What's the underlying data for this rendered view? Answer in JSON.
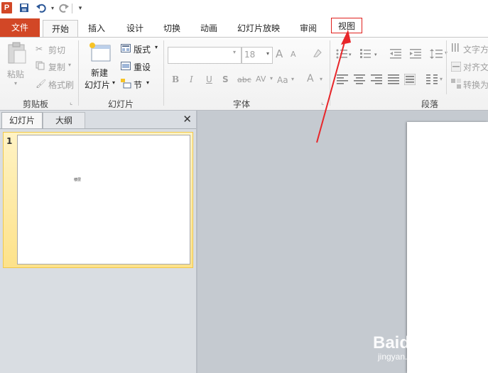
{
  "qat": {
    "logo": "P"
  },
  "tabs": [
    {
      "label": "文件"
    },
    {
      "label": "开始"
    },
    {
      "label": "插入"
    },
    {
      "label": "设计"
    },
    {
      "label": "切换"
    },
    {
      "label": "动画"
    },
    {
      "label": "幻灯片放映"
    },
    {
      "label": "审阅"
    },
    {
      "label": "视图"
    }
  ],
  "clipboard": {
    "paste": "粘贴",
    "cut": "剪切",
    "copy": "复制",
    "format_painter": "格式刷",
    "group": "剪贴板"
  },
  "slides": {
    "new_slide_line1": "新建",
    "new_slide_line2": "幻灯片",
    "layout": "版式",
    "reset": "重设",
    "section": "节",
    "group": "幻灯片"
  },
  "font": {
    "size": "18",
    "bold": "B",
    "italic": "I",
    "underline": "U",
    "shadow": "S",
    "strike": "abc",
    "spacing": "AV",
    "case": "Aa",
    "color": "A",
    "grow": "A",
    "shrink": "A",
    "group": "字体"
  },
  "paragraph": {
    "text_direction": "文字方",
    "align_text": "对齐文",
    "convert": "转换为",
    "group": "段落"
  },
  "panel": {
    "tab_slides": "幻灯片",
    "tab_outline": "大纲",
    "close": "✕",
    "slide_number": "1",
    "thumb_text": "楼层"
  },
  "watermark": {
    "line1": "Baidu 经验",
    "line2": "jingyan.baidu.com"
  },
  "colors": {
    "accent": "#d24726",
    "highlight": "#e0201d"
  }
}
